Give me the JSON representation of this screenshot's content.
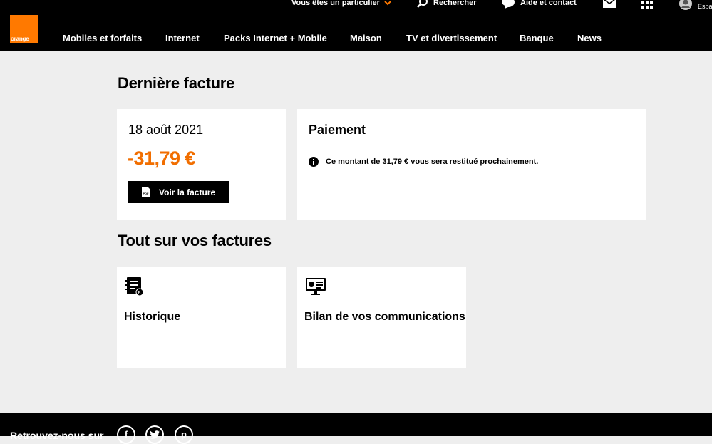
{
  "header": {
    "logo_text": "orange",
    "profile_label": "Vous êtes un particulier",
    "search_label": "Rechercher",
    "help_label": "Aide et contact",
    "account_label": "Espa",
    "nav": [
      "Mobiles et forfaits",
      "Internet",
      "Packs Internet + Mobile",
      "Maison",
      "TV et divertissement",
      "Banque",
      "News"
    ]
  },
  "last_bill": {
    "heading": "Dernière facture",
    "date": "18 août 2021",
    "amount": "-31,79 €",
    "button_label": "Voir la facture",
    "pdf_badge": "PDF"
  },
  "payment": {
    "title": "Paiement",
    "message": "Ce montant de 31,79 € vous sera restitué prochainement."
  },
  "all_bills": {
    "heading": "Tout sur vos factures",
    "tiles": [
      "Historique",
      "Bilan de vos communications"
    ]
  },
  "footer": {
    "label": "Retrouvez-nous sur"
  },
  "colors": {
    "brand_orange": "#ff7900",
    "amount_orange": "#f16e00",
    "page_bg": "#eeeeee",
    "header_bg": "#000000"
  }
}
